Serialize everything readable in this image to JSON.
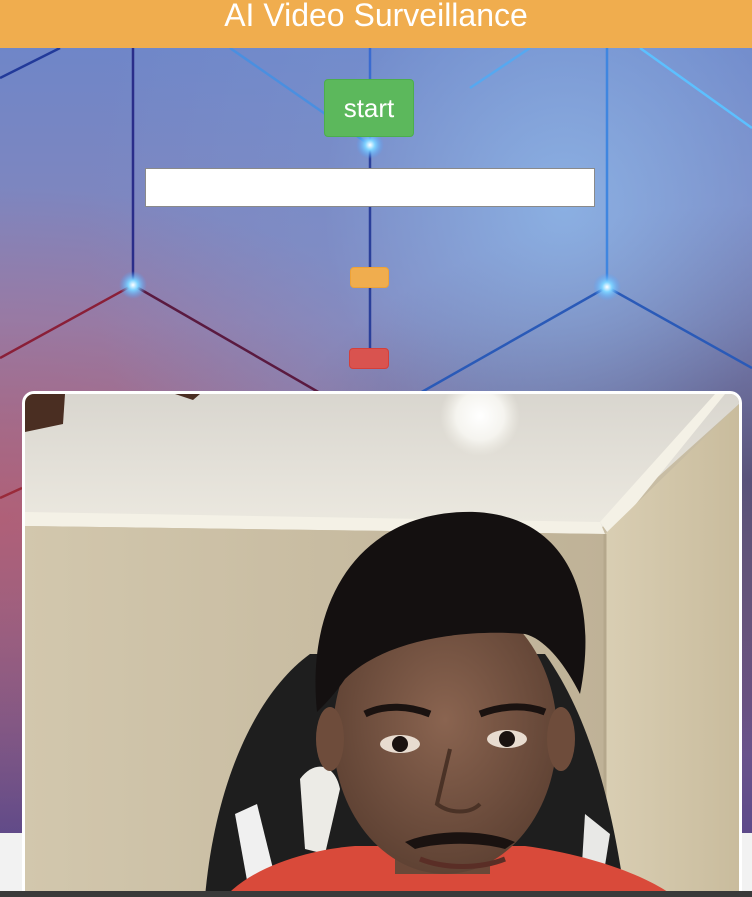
{
  "header": {
    "title": "AI Video Surveillance"
  },
  "controls": {
    "start_label": "start",
    "url_input_value": "",
    "warning_button_label": "",
    "danger_button_label": ""
  },
  "colors": {
    "header": "#f0ad4e",
    "start_button": "#5cb85c",
    "warning_button": "#f0ad4e",
    "danger_button": "#d9534f"
  },
  "video": {
    "description_icon": "webcam-feed"
  }
}
